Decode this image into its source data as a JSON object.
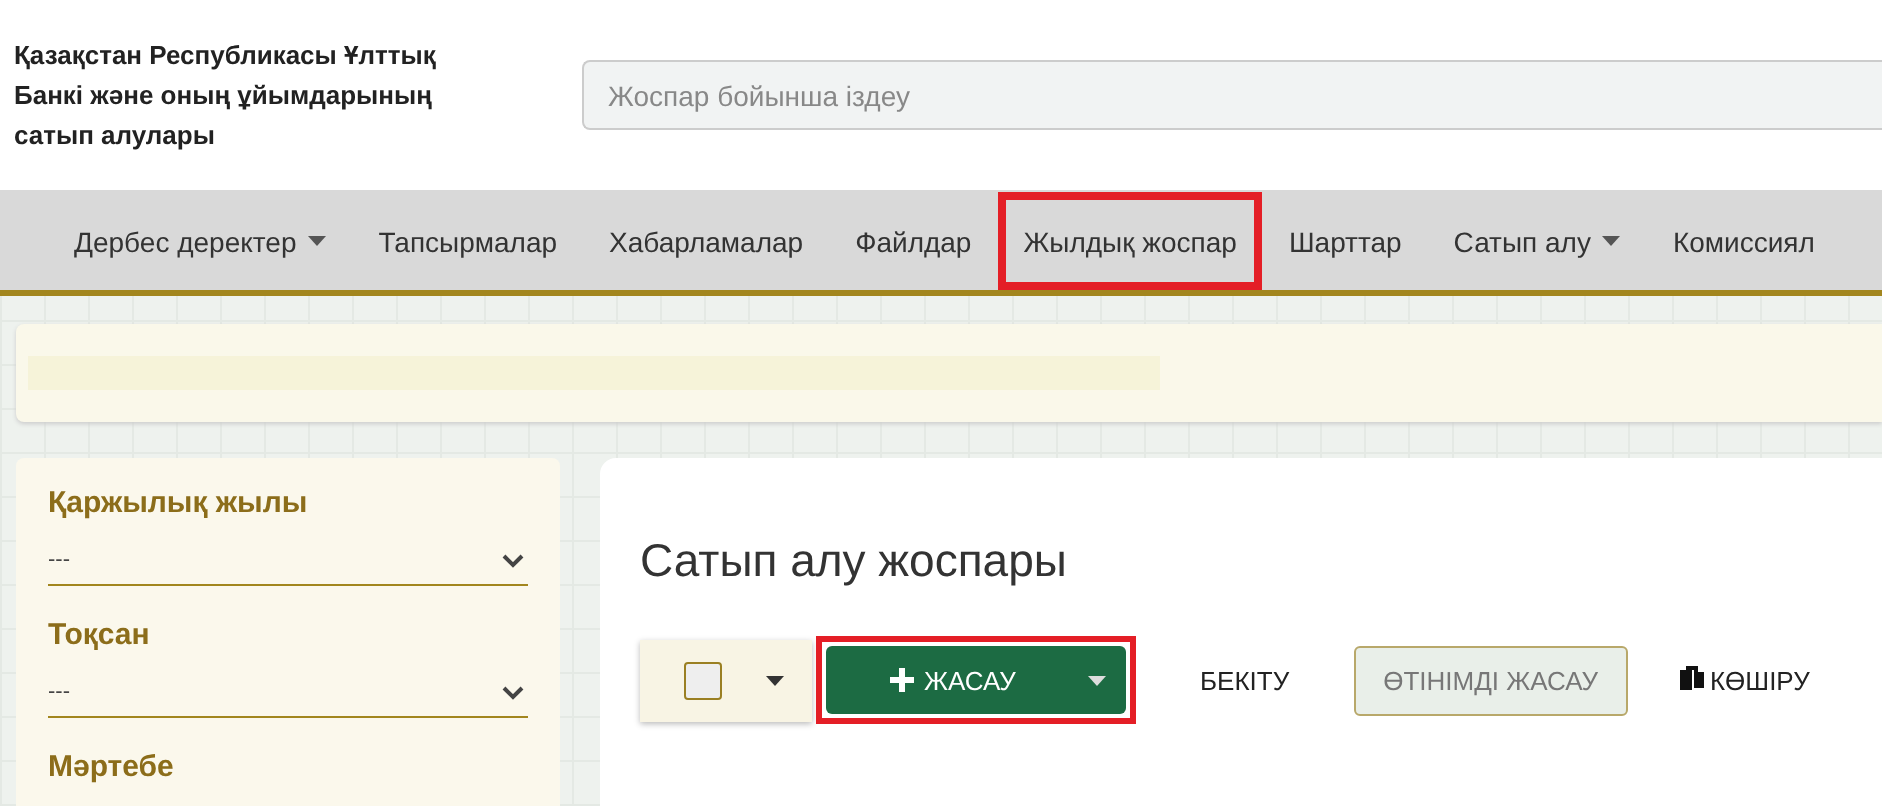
{
  "header": {
    "title": "Қазақстан Республикасы Ұлттық Банкі және оның ұйымдарының сатып алулары",
    "search": {
      "placeholder": "Жоспар бойынша іздеу"
    }
  },
  "nav": [
    {
      "label": "Дербес деректер",
      "dropdown": true,
      "highlighted": false
    },
    {
      "label": "Тапсырмалар",
      "dropdown": false,
      "highlighted": false
    },
    {
      "label": "Хабарламалар",
      "dropdown": false,
      "highlighted": false
    },
    {
      "label": "Файлдар",
      "dropdown": false,
      "highlighted": false
    },
    {
      "label": "Жылдық жоспар",
      "dropdown": false,
      "highlighted": true
    },
    {
      "label": "Шарттар",
      "dropdown": false,
      "highlighted": false
    },
    {
      "label": "Сатып алу",
      "dropdown": true,
      "highlighted": false
    },
    {
      "label": "Комиссиял",
      "dropdown": false,
      "highlighted": false
    }
  ],
  "filters": [
    {
      "label": "Қаржылық жылы",
      "value": "---"
    },
    {
      "label": "Тоқсан",
      "value": "---"
    },
    {
      "label": "Мәртебе"
    }
  ],
  "main": {
    "title": "Сатып алу жоспары",
    "select_all": {
      "checked": false
    },
    "create_button": {
      "label": "ЖАСАУ",
      "highlighted": true
    },
    "actions": [
      {
        "label": "БЕКІТУ",
        "kind": "text"
      },
      {
        "label": "ӨТІНІМДІ ЖАСАУ",
        "kind": "outlined"
      },
      {
        "label": "КӨШІРУ",
        "kind": "icon"
      }
    ]
  }
}
